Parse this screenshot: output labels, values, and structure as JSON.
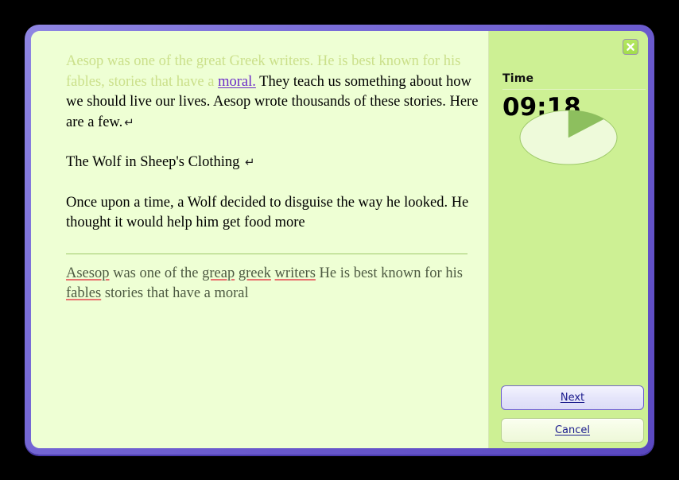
{
  "window": {
    "frame_color": "#6a5acd",
    "document_bg": "#eeffd4",
    "sidebar_bg": "#cdf094"
  },
  "document": {
    "paragraph1": {
      "faded_text": "Aesop was one of the great Greek writers. He is best known for his fables, stories that have a ",
      "link_text": "moral.",
      "rest_text": " They teach us something about how we should live our lives. Aesop wrote thousands of these stories. Here are a few.",
      "pilcrow": "↵"
    },
    "paragraph2": {
      "text": "The Wolf in Sheep's Clothing ",
      "pilcrow": "↵"
    },
    "paragraph3": {
      "text": "Once upon a time, a Wolf decided to disguise the way he looked. He thought it would help him get food more"
    }
  },
  "typed_answer": {
    "segments": [
      {
        "text": "Asesop",
        "misspelled": true
      },
      {
        "text": " was one of the ",
        "misspelled": false
      },
      {
        "text": "greap",
        "misspelled": true
      },
      {
        "text": " ",
        "misspelled": false
      },
      {
        "text": "greek",
        "misspelled": true
      },
      {
        "text": " ",
        "misspelled": false
      },
      {
        "text": "writers",
        "misspelled": true
      },
      {
        "text": " He is best known for his ",
        "misspelled": false
      },
      {
        "text": "fables",
        "misspelled": true
      },
      {
        "text": " stories that have a moral",
        "misspelled": false
      }
    ],
    "spellcheck_underline_color": "#e8736f",
    "text_color": "#4d5a42"
  },
  "sidebar": {
    "close_icon": "close-icon",
    "time_label": "Time",
    "time_value": "09:18",
    "pie": {
      "elapsed_fraction": 0.13,
      "fill_color": "#eefada",
      "wedge_color": "#8dbf5e",
      "outline_color": "#9ec96a"
    }
  },
  "buttons": {
    "next": {
      "accel": "N",
      "rest": "ext"
    },
    "cancel": {
      "accel": "C",
      "rest": "ancel"
    }
  }
}
